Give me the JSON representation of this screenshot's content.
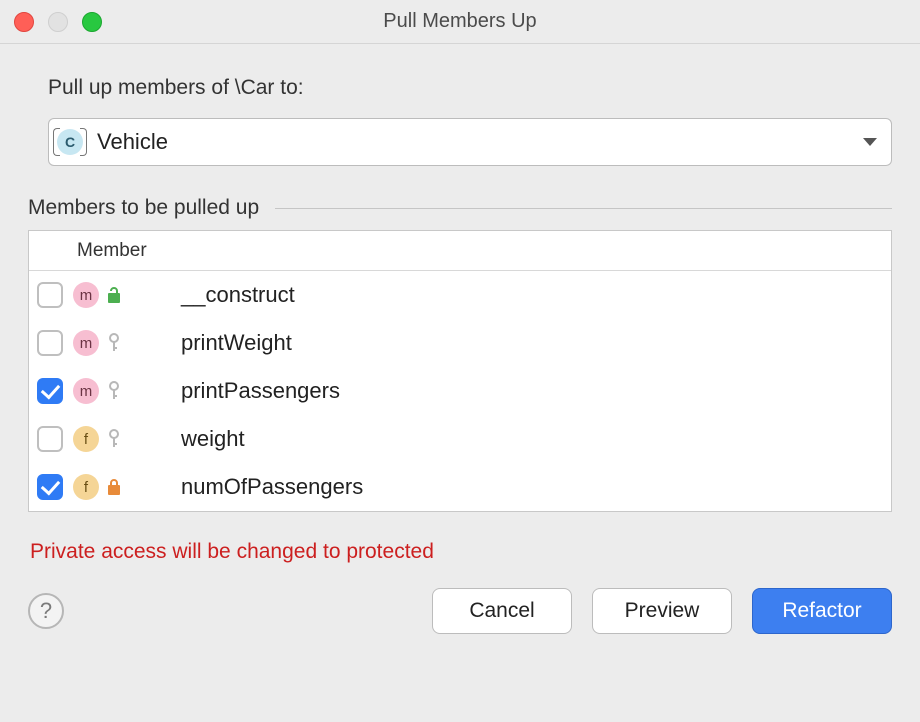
{
  "window": {
    "title": "Pull Members Up"
  },
  "prompt": "Pull up members of \\Car to:",
  "target": {
    "icon_letter": "C",
    "name": "Vehicle"
  },
  "members_section_label": "Members to be pulled up",
  "table": {
    "header": "Member",
    "rows": [
      {
        "checked": false,
        "kind": "m",
        "visibility": "public",
        "name": "__construct"
      },
      {
        "checked": false,
        "kind": "m",
        "visibility": "protected",
        "name": "printWeight"
      },
      {
        "checked": true,
        "kind": "m",
        "visibility": "protected",
        "name": "printPassengers"
      },
      {
        "checked": false,
        "kind": "f",
        "visibility": "protected",
        "name": "weight"
      },
      {
        "checked": true,
        "kind": "f",
        "visibility": "private",
        "name": "numOfPassengers"
      }
    ]
  },
  "warning": "Private access will be changed to protected",
  "buttons": {
    "cancel": "Cancel",
    "preview": "Preview",
    "refactor": "Refactor"
  },
  "help_glyph": "?"
}
